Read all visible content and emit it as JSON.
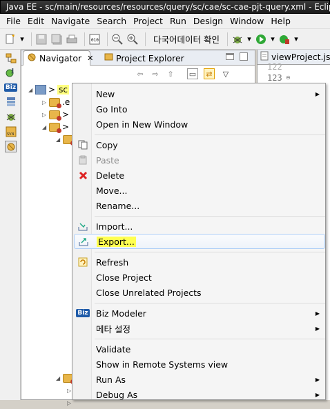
{
  "window": {
    "title": "Java EE - sc/main/resources/resources/query/sc/cae/sc-cae-pjt-query.xml - Eclipse"
  },
  "menubar": [
    "File",
    "Edit",
    "Navigate",
    "Search",
    "Project",
    "Run",
    "Design",
    "Window",
    "Help"
  ],
  "toolbar": {
    "korean_button": "다국어데이터 확인"
  },
  "navigator": {
    "tabs": [
      {
        "label": "Navigator",
        "active": true
      },
      {
        "label": "Project Explorer",
        "active": false
      }
    ],
    "tree": {
      "project_label": "sc",
      "project_prefix": ">",
      "child_labels": [
        ".e",
        ">",
        ">"
      ]
    }
  },
  "editor": {
    "tab_label": "viewProject.jsp",
    "line_numbers": [
      "122",
      "123"
    ]
  },
  "context_menu": {
    "items": [
      {
        "label": "New",
        "submenu": true,
        "icon": ""
      },
      {
        "label": "Go Into",
        "icon": ""
      },
      {
        "label": "Open in New Window",
        "icon": ""
      },
      {
        "label": "Copy",
        "icon": "copy-icon"
      },
      {
        "label": "Paste",
        "icon": "paste-icon",
        "disabled": true
      },
      {
        "label": "Delete",
        "icon": "delete-icon"
      },
      {
        "label": "Move...",
        "icon": ""
      },
      {
        "label": "Rename...",
        "icon": ""
      },
      {
        "label": "Import...",
        "icon": "import-icon"
      },
      {
        "label": "Export...",
        "icon": "export-icon",
        "hover": true
      },
      {
        "label": "Refresh",
        "icon": "refresh-icon"
      },
      {
        "label": "Close Project",
        "icon": ""
      },
      {
        "label": "Close Unrelated Projects",
        "icon": ""
      },
      {
        "label": "Biz Modeler",
        "icon": "biz-icon",
        "icon_text": "Biz",
        "submenu": true
      },
      {
        "label": "메타 설정",
        "submenu": true,
        "icon": ""
      },
      {
        "label": "Validate",
        "icon": ""
      },
      {
        "label": "Show in Remote Systems view",
        "icon": ""
      },
      {
        "label": "Run As",
        "submenu": true,
        "icon": ""
      },
      {
        "label": "Debug As",
        "submenu": true,
        "icon": ""
      }
    ]
  }
}
